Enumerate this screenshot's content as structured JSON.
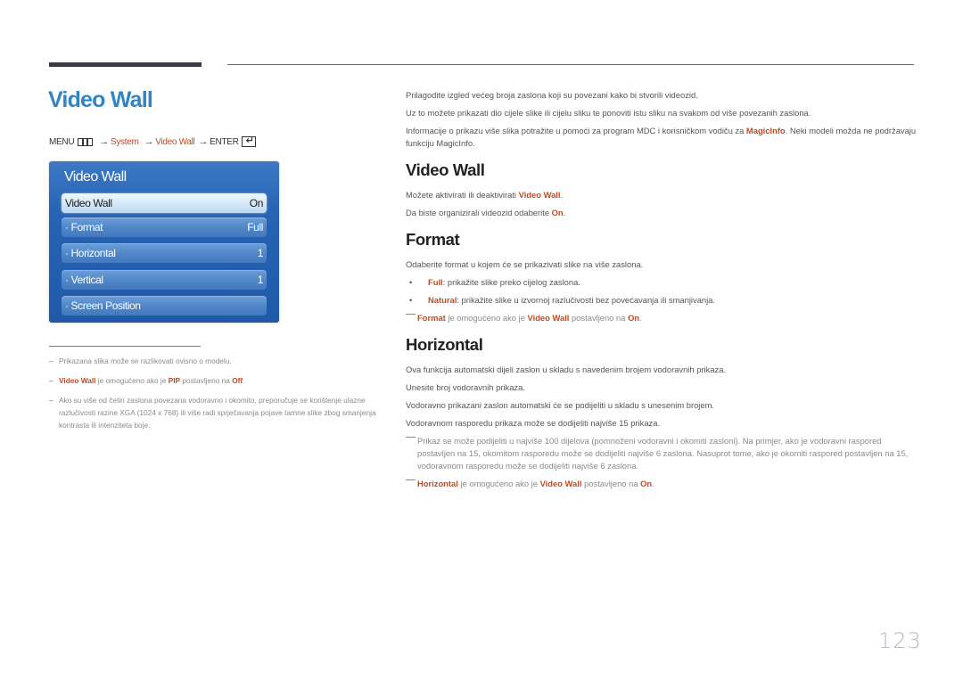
{
  "page": {
    "title": "Video Wall",
    "page_number": "123"
  },
  "menu_path": {
    "menu": "MENU",
    "menu_icon": "menu-grid-icon",
    "arrow": "→",
    "system": "System",
    "video_wall": "Video Wall",
    "enter": "ENTER",
    "enter_icon": "enter-return-icon",
    "enter_glyph": "↵"
  },
  "osd": {
    "title": "Video Wall",
    "items": [
      {
        "label": "Video Wall",
        "value": "On",
        "selected": true
      },
      {
        "label": "· Format",
        "value": "Full"
      },
      {
        "label": "· Horizontal",
        "value": "1"
      },
      {
        "label": "· Vertical",
        "value": "1"
      },
      {
        "label": "· Screen Position",
        "value": ""
      }
    ]
  },
  "footnotes": {
    "dash": "–",
    "items": [
      {
        "text": "Prikazana slika može se razlikovati ovisno o modelu."
      },
      {
        "hl1": "Video Wall",
        "t1": " je omogućeno ako je ",
        "hl2": "PIP",
        "t2": " postavljeno na ",
        "hl3": "Off",
        "t3": "."
      },
      {
        "text": "Ako su više od četiri zaslona povezana vodoravno i okomito, preporučuje se korištenje ulazne razlučivosti razine XGA (1024 x 768) ili više radi sprječavanja pojave tamne slike zbog smanjenja kontrasta ili intenziteta boje."
      }
    ]
  },
  "intro": {
    "p1": "Prilagodite izgled većeg broja zaslona koji su povezani kako bi stvorili videozid.",
    "p2": "Uz to možete prikazati dio cijele slike ili cijelu sliku te ponoviti istu sliku na svakom od više povezanih zaslona.",
    "p3_a": "Informacije o prikazu više slika potražite u pomoći za program MDC i korisničkom vodiču za ",
    "p3_hl": "MagicInfo",
    "p3_b": ". Neki modeli možda ne podržavaju funkciju MagicInfo."
  },
  "sections": {
    "video_wall": {
      "heading": "Video Wall",
      "p1_a": "Možete aktivirati ili deaktivirati ",
      "p1_hl": "Video Wall",
      "p1_b": ".",
      "p2_a": "Da biste organizirali videozid odaberite ",
      "p2_hl": "On",
      "p2_b": "."
    },
    "format": {
      "heading": "Format",
      "p1": "Odaberite format u kojem će se prikazivati slike na više zaslona.",
      "bullet_glyph": "•",
      "bullets": [
        {
          "hl": "Full",
          "text": ": prikažite slike preko cijelog zaslona."
        },
        {
          "hl": "Natural",
          "text": ": prikažite slike u izvornoj razlučivosti bez povećavanja ili smanjivanja."
        }
      ],
      "note": {
        "hl1": "Format",
        "t1": " je omogućeno ako je ",
        "hl2": "Video Wall",
        "t2": " postavljeno na ",
        "hl3": "On",
        "t3": "."
      }
    },
    "horizontal": {
      "heading": "Horizontal",
      "p1": "Ova funkcija automatski dijeli zaslon u skladu s navedenim brojem vodoravnih prikaza.",
      "p2": "Unesite broj vodoravnih prikaza.",
      "p3": "Vodoravno prikazani zaslon automatski će se podijeliti u skladu s unesenim brojem.",
      "p4": "Vodoravnom rasporedu prikaza može se dodijeliti najviše 15 prikaza.",
      "note1": "Prikaz se može podijeliti u najviše 100 dijelova (pomnoženi vodoravni i okomiti zasloni). Na primjer, ako je vodoravni raspored postavljen na 15, okomitom rasporedu može se dodijeliti najviše 6 zaslona. Nasuprot tome, ako je okomiti raspored postavljen na 15, vodoravnom rasporedu može se dodijeliti najviše 6 zaslona.",
      "note2": {
        "hl1": "Horizontal",
        "t1": " je omogućeno ako je ",
        "hl2": "Video Wall",
        "t2": " postavljeno na ",
        "hl3": "On",
        "t3": "."
      }
    }
  }
}
